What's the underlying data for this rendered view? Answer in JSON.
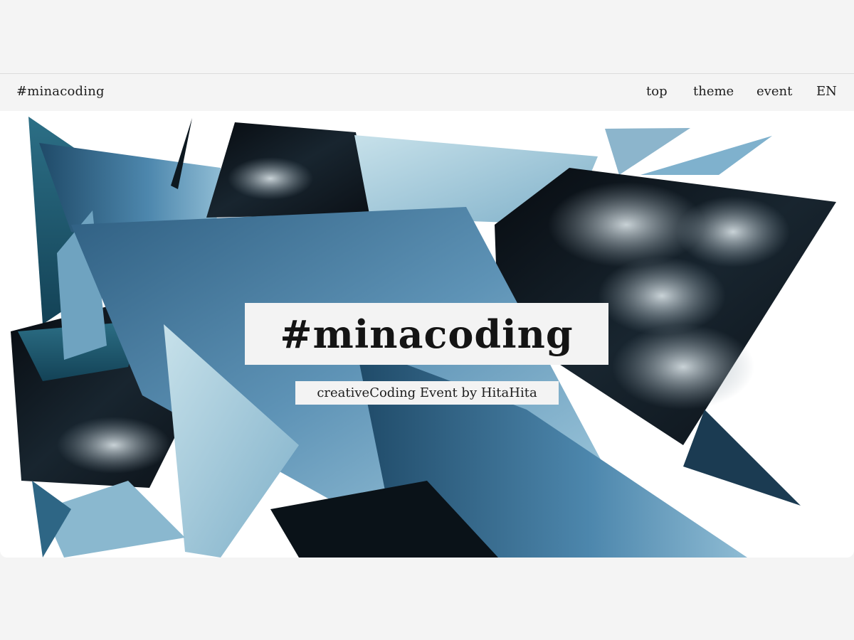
{
  "header": {
    "brand": "#minacoding",
    "nav": [
      {
        "label": "top"
      },
      {
        "label": "theme"
      },
      {
        "label": "event"
      },
      {
        "label": "EN"
      }
    ]
  },
  "hero": {
    "title": "#minacoding",
    "subtitle": "creativeCoding Event by HitaHita"
  },
  "colors": {
    "page_background": "#f4f4f4",
    "hero_background": "#ffffff",
    "shard_dark": "#0c1118",
    "shard_mid": "#3f7196",
    "shard_light": "#9fc7dc",
    "label_background": "#f3f3f3"
  }
}
